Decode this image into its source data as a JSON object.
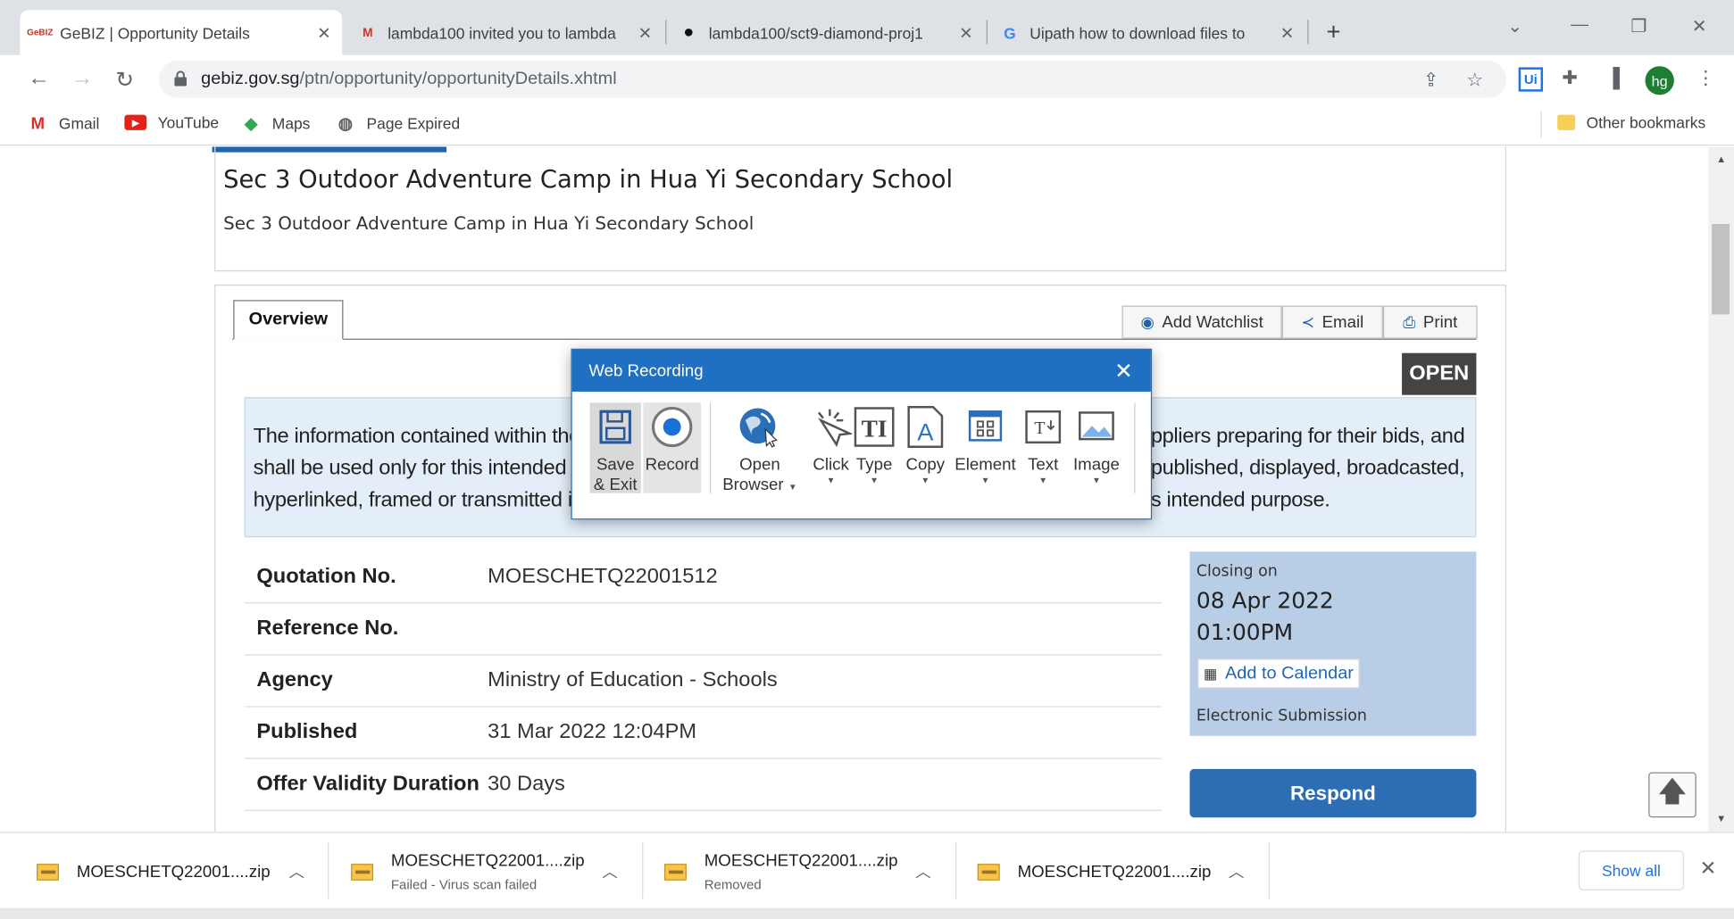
{
  "tabs": [
    {
      "title": "GeBIZ | Opportunity Details",
      "favicon": "gebiz-icon",
      "fav_text": "GeBIZ",
      "active": true
    },
    {
      "title": "lambda100 invited you to lambda",
      "favicon": "gmail-icon",
      "fav_text": "M",
      "active": false
    },
    {
      "title": "lambda100/sct9-diamond-proj1",
      "favicon": "github-icon",
      "fav_text": "●",
      "active": false
    },
    {
      "title": "Uipath how to download files to",
      "favicon": "google-icon",
      "fav_text": "G",
      "active": false
    }
  ],
  "address": {
    "host": "gebiz.gov.sg",
    "path": "/ptn/opportunity/opportunityDetails.xhtml"
  },
  "profile_initials": "hg",
  "bookmarks": [
    {
      "label": "Gmail",
      "icon": "gmail-icon"
    },
    {
      "label": "YouTube",
      "icon": "youtube-icon"
    },
    {
      "label": "Maps",
      "icon": "maps-icon"
    },
    {
      "label": "Page Expired",
      "icon": "globe-icon"
    }
  ],
  "other_bookmarks": "Other bookmarks",
  "page": {
    "title": "Sec 3 Outdoor Adventure Camp in Hua Yi Secondary School",
    "subtitle": "Sec 3 Outdoor Adventure Camp in Hua Yi Secondary School",
    "overview_tab": "Overview",
    "actions": {
      "watchlist": "Add Watchlist",
      "email": "Email",
      "print": "Print"
    },
    "status": "OPEN",
    "notice_left": [
      "The information contained within the p",
      "shall be used only for this intended pu",
      "hyperlinked, framed or transmitted in a"
    ],
    "notice_right": [
      "ppliers preparing for their bids, and",
      "published, displayed, broadcasted,",
      "s intended purpose."
    ],
    "details": [
      {
        "label": "Quotation No.",
        "value": "MOESCHETQ22001512"
      },
      {
        "label": "Reference No.",
        "value": ""
      },
      {
        "label": "Agency",
        "value": "Ministry of Education - Schools"
      },
      {
        "label": "Published",
        "value": "31 Mar 2022 12:04PM"
      },
      {
        "label": "Offer Validity Duration",
        "value": "30 Days"
      }
    ],
    "closing": {
      "label": "Closing on",
      "date": "08 Apr 2022",
      "time": "01:00PM",
      "calendar": "Add to Calendar",
      "submission": "Electronic Submission"
    },
    "respond": "Respond"
  },
  "web_recording": {
    "title": "Web Recording",
    "buttons": {
      "save": [
        "Save",
        "& Exit"
      ],
      "record": "Record",
      "open_browser": [
        "Open",
        "Browser"
      ],
      "click": "Click",
      "type": "Type",
      "copy": "Copy",
      "element": "Element",
      "text": "Text",
      "image": "Image"
    }
  },
  "downloads": [
    {
      "name": "MOESCHETQ22001....zip",
      "status": ""
    },
    {
      "name": "MOESCHETQ22001....zip",
      "status": "Failed - Virus scan failed"
    },
    {
      "name": "MOESCHETQ22001....zip",
      "status": "Removed"
    },
    {
      "name": "MOESCHETQ22001....zip",
      "status": ""
    }
  ],
  "show_all": "Show all",
  "colors": {
    "accent": "#1f6fc2",
    "respond": "#2d6db3",
    "closing_bg": "#b7cee6",
    "notice_bg": "#e3eef8"
  }
}
